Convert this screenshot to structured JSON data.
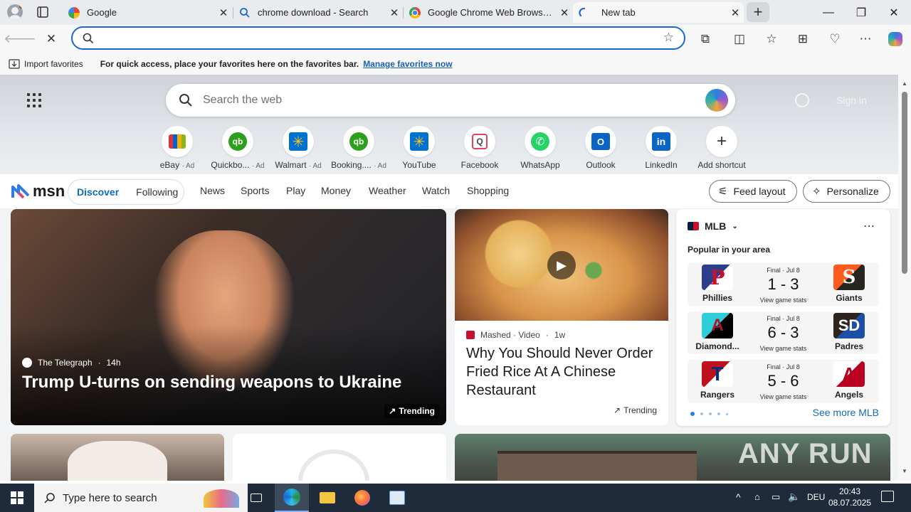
{
  "tabs": [
    {
      "title": "Google",
      "close": "✕"
    },
    {
      "title": "chrome download - Search",
      "close": "✕"
    },
    {
      "title": "Google Chrome Web Browser: Fir",
      "close": "✕"
    },
    {
      "title": "New tab",
      "close": "✕"
    }
  ],
  "window_controls": {
    "minimize": "—",
    "restore": "❐",
    "close": "✕"
  },
  "favorites_bar": {
    "import_label": "Import favorites",
    "message": "For quick access, place your favorites here on the favorites bar.",
    "manage_link": "Manage favorites now"
  },
  "newtab": {
    "search_placeholder": "Search the web",
    "sign_in": "Sign in",
    "shortcuts": [
      {
        "label": "eBay",
        "ad": "· Ad"
      },
      {
        "label": "Quickbo...",
        "ad": "· Ad"
      },
      {
        "label": "Walmart",
        "ad": "· Ad"
      },
      {
        "label": "Booking....",
        "ad": "· Ad"
      },
      {
        "label": "YouTube",
        "ad": ""
      },
      {
        "label": "Facebook",
        "ad": ""
      },
      {
        "label": "WhatsApp",
        "ad": ""
      },
      {
        "label": "Outlook",
        "ad": ""
      },
      {
        "label": "LinkedIn",
        "ad": ""
      },
      {
        "label": "Add shortcut",
        "ad": ""
      }
    ]
  },
  "msn": {
    "logo": "msn",
    "discover": "Discover",
    "following": "Following",
    "nav": [
      "News",
      "Sports",
      "Play",
      "Money",
      "Weather",
      "Watch",
      "Shopping"
    ],
    "feed_layout": "Feed layout",
    "personalize": "Personalize"
  },
  "main_story": {
    "source": "The Telegraph",
    "age": "14h",
    "headline": "Trump U-turns on sending weapons to Ukraine",
    "trending": "Trending"
  },
  "side_story": {
    "source": "Mashed · Video",
    "age": "1w",
    "headline": "Why You Should Never Order Fried Rice At A Chinese Restaurant",
    "trending": "Trending"
  },
  "mlb": {
    "title": "MLB",
    "subtitle": "Popular in your area",
    "see_more": "See more MLB",
    "games": [
      {
        "status": "Final · Jul 8",
        "score": "1 - 3",
        "stats": "View game stats",
        "home": "Phillies",
        "away": "Giants",
        "home_color": "#c8102e",
        "away_color": "#fd5a1e"
      },
      {
        "status": "Final · Jul 8",
        "score": "6 - 3",
        "stats": "View game stats",
        "home": "Diamond...",
        "away": "Padres",
        "home_color": "#a71930",
        "away_color": "#2f241d"
      },
      {
        "status": "Final · Jul 8",
        "score": "5 - 6",
        "stats": "View game stats",
        "home": "Rangers",
        "away": "Angels",
        "home_color": "#c0111f",
        "away_color": "#ba0021"
      }
    ]
  },
  "taskbar": {
    "search_placeholder": "Type here to search",
    "lang": "DEU",
    "time": "20:43",
    "date": "08.07.2025"
  },
  "watermark": "ANY RUN"
}
